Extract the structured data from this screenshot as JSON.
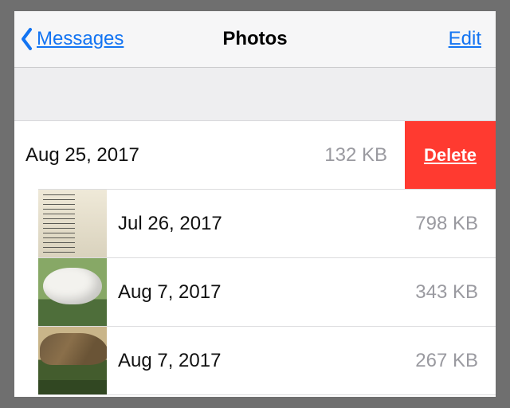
{
  "nav": {
    "back_label": "Messages",
    "title": "Photos",
    "edit_label": "Edit"
  },
  "delete_label": "Delete",
  "rows": [
    {
      "date": "Aug 25, 2017",
      "size": "132 KB",
      "swiped": true,
      "thumb": null
    },
    {
      "date": "Jul 26, 2017",
      "size": "798 KB",
      "swiped": false,
      "thumb": "t1"
    },
    {
      "date": "Aug 7, 2017",
      "size": "343 KB",
      "swiped": false,
      "thumb": "t2"
    },
    {
      "date": "Aug 7, 2017",
      "size": "267 KB",
      "swiped": false,
      "thumb": "t3"
    }
  ]
}
